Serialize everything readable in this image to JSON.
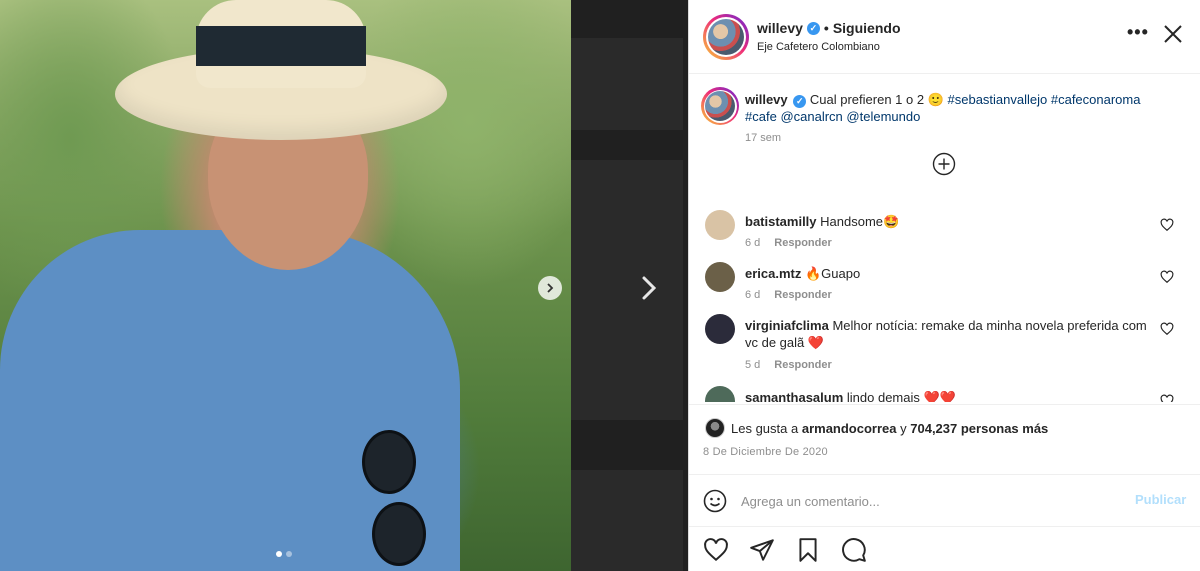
{
  "post": {
    "carousel": {
      "count": 2,
      "active_index": 0
    }
  },
  "header": {
    "username": "willevy",
    "verified_icon": "verified-check-icon",
    "separator": "•",
    "following_label": "Siguiendo",
    "location": "Eje Cafetero Colombiano",
    "more_icon": "more-options-icon",
    "close_icon": "close-icon"
  },
  "caption": {
    "username": "willevy",
    "text": "Cual prefieren 1 o 2 🙂",
    "tags": [
      "#sebastianvallejo",
      "#cafeconaroma",
      "#cafe",
      "@canalrcn",
      "@telemundo"
    ],
    "time": "17 sem",
    "load_more_icon": "plus-circle-icon"
  },
  "comments": [
    {
      "username": "batistamilly",
      "text": "Handsome🤩",
      "time": "6 d",
      "reply": "Responder",
      "avatar_color": "#d9c3a5"
    },
    {
      "username": "erica.mtz",
      "text": "🔥Guapo",
      "time": "6 d",
      "reply": "Responder",
      "avatar_color": "#6b6048"
    },
    {
      "username": "virginiafclima",
      "text": "Melhor notícia: remake da minha novela preferida com vc de galã ❤️",
      "time": "5 d",
      "reply": "Responder",
      "avatar_color": "#2b2b3a"
    },
    {
      "username": "samanthasalum",
      "text": "lindo demais ❤️❤️",
      "time": "",
      "reply": "",
      "avatar_color": "#4e6a5a"
    }
  ],
  "likes": {
    "prefix": "Les gusta a",
    "user": "armandocorrea",
    "connector": "y",
    "count_text": "704,237 personas más"
  },
  "date": "8 De Diciembre De 2020",
  "comment_box": {
    "placeholder": "Agrega un comentario...",
    "value": "",
    "publish_label": "Publicar",
    "emoji_icon": "emoji-icon"
  },
  "actions": [
    "like-icon",
    "share-icon",
    "save-icon",
    "comment-icon"
  ],
  "colors": {
    "accent": "#3897f0",
    "link": "#00376b",
    "publish_disabled": "#b2dffc",
    "heart": "#ed4956"
  }
}
